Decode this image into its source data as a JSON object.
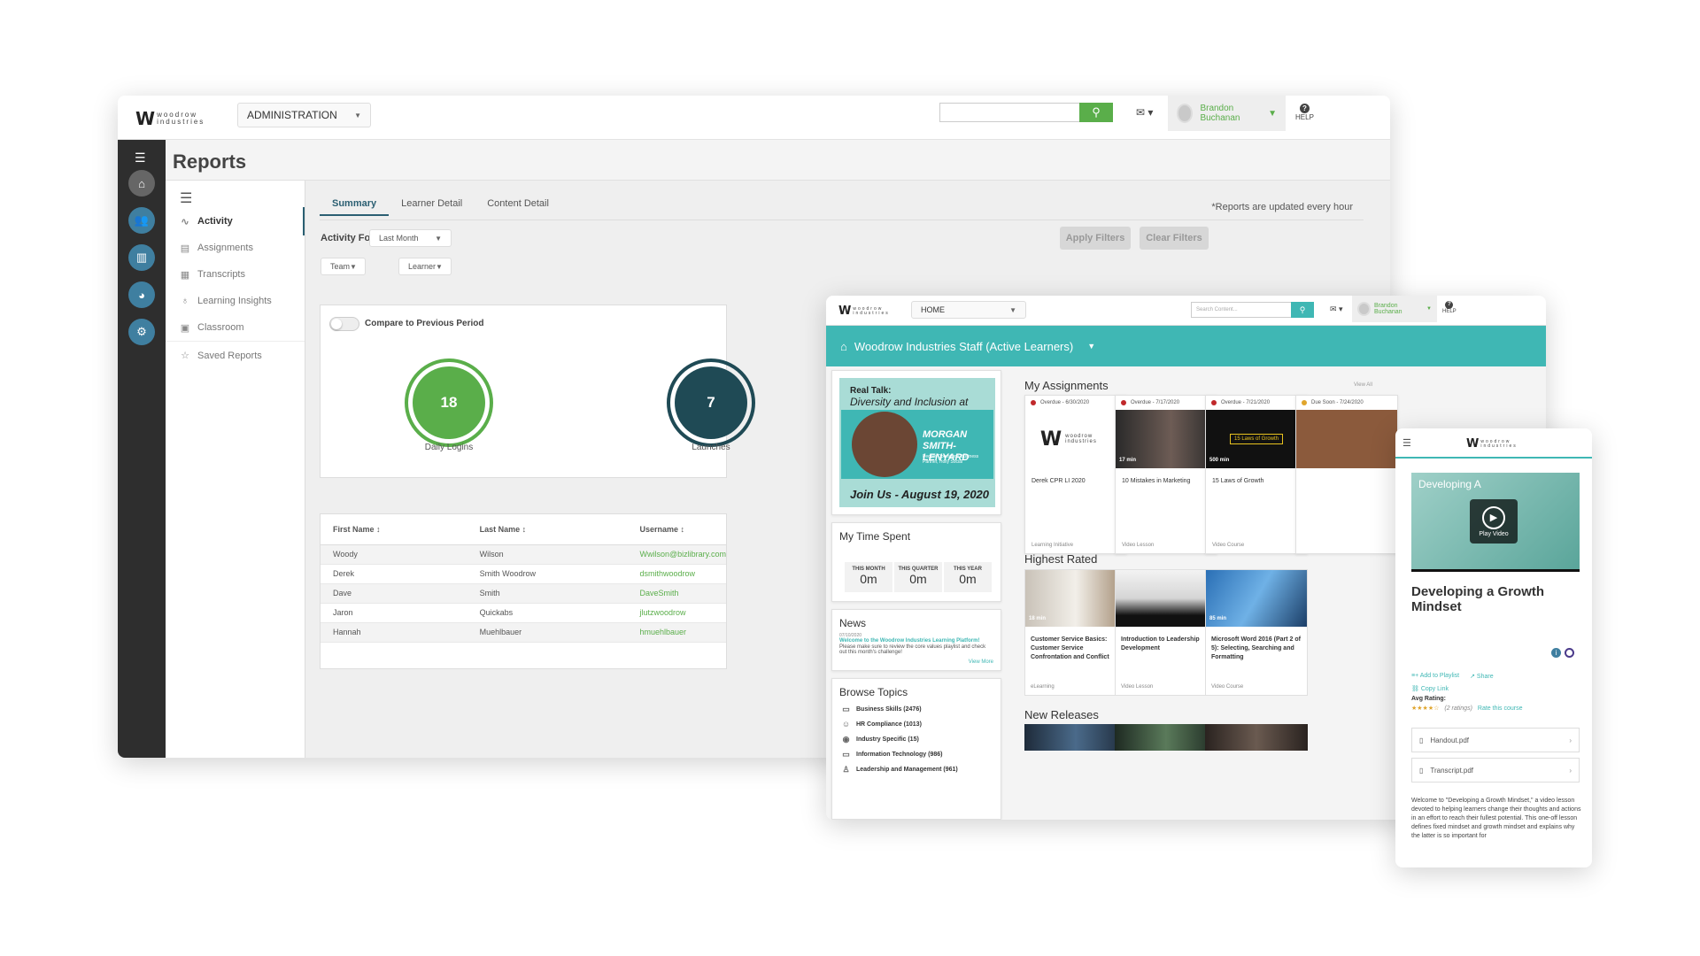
{
  "admin": {
    "brand": "woodrow industries",
    "module_select": "ADMINISTRATION",
    "user_name": "Brandon Buchanan",
    "help_label": "HELP",
    "page_title": "Reports",
    "subnav": [
      "Activity",
      "Assignments",
      "Transcripts",
      "Learning Insights",
      "Classroom",
      "Saved Reports"
    ],
    "tabs": [
      "Summary",
      "Learner Detail",
      "Content Detail"
    ],
    "update_note": "*Reports are updated every hour",
    "activity_for_label": "Activity For:",
    "activity_for_value": "Last Month",
    "team_filter": "Team",
    "learner_filter": "Learner",
    "apply_filters": "Apply Filters",
    "clear_filters": "Clear Filters",
    "compare_label": "Compare to Previous Period",
    "metrics": [
      {
        "value": "18",
        "label": "Daily Logins",
        "color": "#5aae4a"
      },
      {
        "value": "7",
        "label": "Launches",
        "color": "#1f4a55"
      }
    ],
    "table": {
      "headers": [
        "First Name ↕",
        "Last Name ↕",
        "Username ↕"
      ],
      "rows": [
        [
          "Woody",
          "Wilson",
          "Wwilson@bizlibrary.com"
        ],
        [
          "Derek",
          "Smith Woodrow",
          "dsmithwoodrow"
        ],
        [
          "Dave",
          "Smith",
          "DaveSmith"
        ],
        [
          "Jaron",
          "Quickabs",
          "jlutzwoodrow"
        ],
        [
          "Hannah",
          "Muehlbauer",
          "hmuehlbauer"
        ]
      ]
    }
  },
  "home": {
    "brand": "woodrow industries",
    "module_select": "HOME",
    "search_placeholder": "Search Content...",
    "user_name": "Brandon Buchanan",
    "help_label": "HELP",
    "banner": "Woodrow Industries Staff (Active Learners)",
    "promo": {
      "line1": "Real Talk:",
      "line2": "Diversity and Inclusion at Work",
      "name1": "MORGAN",
      "name2": "SMITH-LENYARD",
      "role": "People Operations Business Partner, Holly Social",
      "join": "Join Us - August 19, 2020"
    },
    "time_spent": {
      "title": "My Time Spent",
      "stats": [
        {
          "label": "THIS MONTH",
          "value": "0m"
        },
        {
          "label": "THIS QUARTER",
          "value": "0m"
        },
        {
          "label": "THIS YEAR",
          "value": "0m"
        }
      ]
    },
    "news": {
      "title": "News",
      "date": "07/10/2020",
      "headline": "Welcome to the Woodrow Industries Learning Platform!",
      "body": "Please make sure to review the core values playlist and check out this month's challenge!",
      "more": "View More"
    },
    "browse": {
      "title": "Browse Topics",
      "topics": [
        "Business Skills (2476)",
        "HR Compliance (1013)",
        "Industry Specific (15)",
        "Information Technology (986)",
        "Leadership and Management (961)"
      ]
    },
    "assignments": {
      "title": "My Assignments",
      "view_all": "View All",
      "items": [
        {
          "due": "Overdue - 6/30/2020",
          "title": "Derek CPR LI 2020",
          "type": "Learning Initiative",
          "duration": ""
        },
        {
          "due": "Overdue - 7/17/2020",
          "title": "10 Mistakes in Marketing",
          "type": "Video Lesson",
          "duration": "17 min"
        },
        {
          "due": "Overdue - 7/21/2020",
          "title": "15 Laws of Growth",
          "type": "Video Course",
          "duration": "500 min"
        },
        {
          "due": "Due Soon - 7/24/2020",
          "title": "",
          "type": "",
          "duration": ""
        }
      ]
    },
    "highest_rated": {
      "title": "Highest Rated",
      "items": [
        {
          "title": "Customer Service Basics: Customer Service Confrontation and Conflict",
          "type": "eLearning",
          "duration": "18 min"
        },
        {
          "title": "Introduction to Leadership Development",
          "type": "Video Lesson",
          "duration": ""
        },
        {
          "title": "Microsoft Word 2016 (Part 2 of 5): Selecting, Searching and Formatting",
          "type": "Video Course",
          "duration": "85 min"
        }
      ]
    },
    "new_releases": {
      "title": "New Releases"
    }
  },
  "mobile": {
    "brand": "woodrow industries",
    "video_overlay": "Developing A",
    "play_label": "Play Video",
    "title": "Developing a Growth Mindset",
    "add_playlist": "Add to Playlist",
    "share": "Share",
    "copy_link": "Copy Link",
    "avg_rating_label": "Avg Rating:",
    "rating": 4.5,
    "rating_stars": "★★★★☆",
    "rating_count": "(2 ratings)",
    "rate_link": "Rate this course",
    "files": [
      "Handout.pdf",
      "Transcript.pdf"
    ],
    "description": "Welcome to \"Developing a Growth Mindset,\" a video lesson devoted to helping learners change their thoughts and actions in an effort to reach their fullest potential. This one-off lesson defines fixed mindset and growth mindset and explains why the latter is so important for"
  },
  "colors": {
    "accent_green": "#5aae4a",
    "teal": "#3fb7b4",
    "dark": "#2e2e2e",
    "overdue": "#c0282b"
  }
}
